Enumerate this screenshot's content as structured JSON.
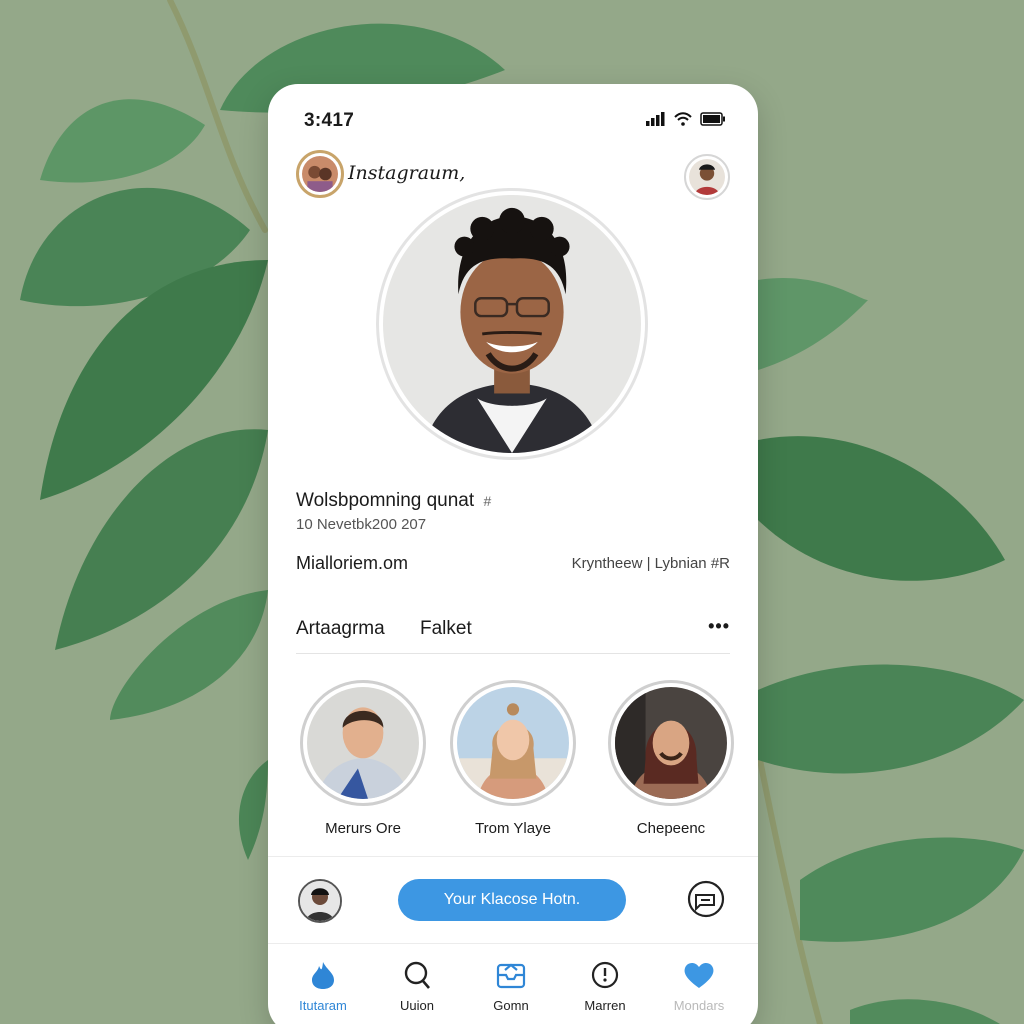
{
  "status_bar": {
    "time": "3:417"
  },
  "header": {
    "app_name": "Instagraum,"
  },
  "profile": {
    "name": "Wolsbpomning qunat",
    "name_suffix": "#",
    "date": "10 Nevetbk200 207",
    "website": "Mialloriem.om",
    "meta": "Kryntheew | Lybnian #R"
  },
  "tabs": [
    {
      "label": "Artaagrma"
    },
    {
      "label": "Falket"
    }
  ],
  "stories": [
    {
      "name": "Merurs Ore"
    },
    {
      "name": "Trom Ylaye"
    },
    {
      "name": "Chepeenc"
    }
  ],
  "compose": {
    "button_label": "Your Klacose Hotn."
  },
  "bottom_nav": [
    {
      "label": "Itutaram",
      "icon": "flame-icon",
      "active": true
    },
    {
      "label": "Uuion",
      "icon": "search-icon"
    },
    {
      "label": "Gomn",
      "icon": "inbox-icon"
    },
    {
      "label": "Marren",
      "icon": "clock-icon"
    },
    {
      "label": "Mondars",
      "icon": "heart-icon"
    }
  ],
  "colors": {
    "accent": "#3d97e3",
    "background": "#94a889",
    "leaf": "#3f7a4b"
  }
}
